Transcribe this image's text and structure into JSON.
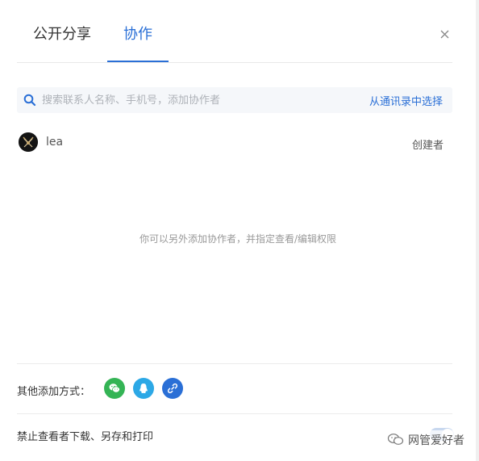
{
  "tabs": {
    "share_label": "公开分享",
    "collab_label": "协作",
    "active": "协作"
  },
  "search": {
    "placeholder": "搜索联系人名称、手机号，添加协作者",
    "value": "",
    "contacts_link": "从通讯录中选择"
  },
  "members": [
    {
      "name": "lea",
      "role": "创建者"
    }
  ],
  "empty_hint": "你可以另外添加协作者，并指定查看/编辑权限",
  "other_methods": {
    "label": "其他添加方式：",
    "buttons": [
      "wechat-icon",
      "qq-icon",
      "link-icon"
    ]
  },
  "restrict": {
    "label": "禁止查看者下载、另存和打印",
    "enabled": false
  },
  "watermark": {
    "text": "网管爱好者"
  },
  "colors": {
    "accent": "#2a6fd6",
    "wechat": "#34b455",
    "qq": "#2ca8e6"
  }
}
